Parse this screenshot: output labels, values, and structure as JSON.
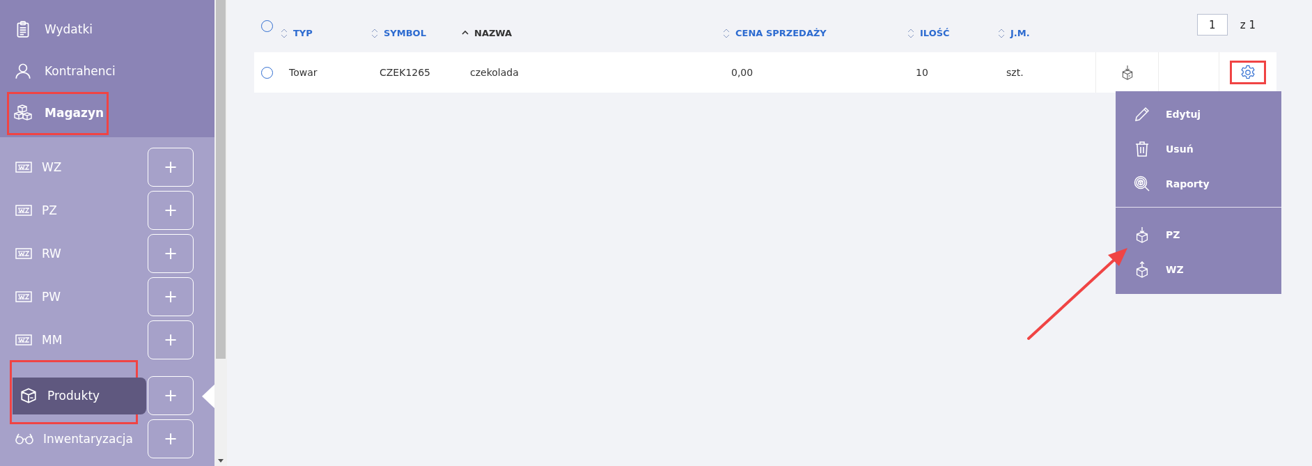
{
  "sidebar": {
    "top_items": [
      {
        "label": "Wydatki",
        "kind": "clipboard",
        "selected": false,
        "highlighted": false
      },
      {
        "label": "Kontrahenci",
        "kind": "person",
        "selected": false,
        "highlighted": false
      },
      {
        "label": "Magazyn",
        "kind": "boxes",
        "selected": true,
        "highlighted": true
      }
    ],
    "sub_items": [
      {
        "label": "WZ",
        "kind": "doc",
        "selected": false,
        "highlighted": false,
        "add_label": "+"
      },
      {
        "label": "PZ",
        "kind": "doc",
        "selected": false,
        "highlighted": false,
        "add_label": "+"
      },
      {
        "label": "RW",
        "kind": "doc",
        "selected": false,
        "highlighted": false,
        "add_label": "+"
      },
      {
        "label": "PW",
        "kind": "doc",
        "selected": false,
        "highlighted": false,
        "add_label": "+"
      },
      {
        "label": "MM",
        "kind": "doc",
        "selected": false,
        "highlighted": false,
        "add_label": "+"
      },
      {
        "label": "Produkty",
        "kind": "box",
        "selected": true,
        "highlighted": true,
        "add_label": "+"
      },
      {
        "label": "Inwentaryzacja",
        "kind": "glasses",
        "selected": false,
        "highlighted": false,
        "add_label": "+"
      }
    ]
  },
  "table": {
    "all_selected": false,
    "columns": [
      {
        "label": "TYP",
        "sorted": false
      },
      {
        "label": "SYMBOL",
        "sorted": false
      },
      {
        "label": "NAZWA",
        "sorted": true
      },
      {
        "label": "CENA SPRZEDAŻY",
        "sorted": false
      },
      {
        "label": "ILOŚĆ",
        "sorted": false
      },
      {
        "label": "J.M.",
        "sorted": false
      }
    ],
    "rows": [
      {
        "selected": false,
        "gear_highlighted": true,
        "cells": [
          "Towar",
          "CZEK1265",
          "czekolada",
          "0,00",
          "10",
          "szt."
        ]
      }
    ]
  },
  "pagination": {
    "page": "1",
    "total": "z 1"
  },
  "row_menu": {
    "sections": [
      [
        {
          "label": "Edytuj",
          "kind": "edit"
        },
        {
          "label": "Usuń",
          "kind": "delete"
        },
        {
          "label": "Raporty",
          "kind": "report"
        }
      ],
      [
        {
          "label": "PZ",
          "kind": "in"
        },
        {
          "label": "WZ",
          "kind": "out"
        }
      ]
    ]
  }
}
